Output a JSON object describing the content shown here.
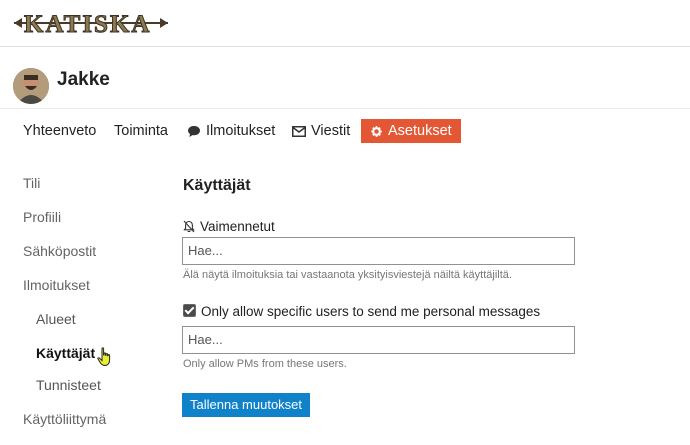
{
  "header": {
    "logo_text": "KATISKA",
    "logo_icon": "fish-trap-logo"
  },
  "profile": {
    "username": "Jakke",
    "avatar_icon": "user-avatar"
  },
  "nav": {
    "tabs": [
      {
        "label": "Yhteenveto"
      },
      {
        "label": "Toiminta"
      },
      {
        "label": "Ilmoitukset",
        "icon": "comment-icon"
      },
      {
        "label": "Viestit",
        "icon": "envelope-icon"
      },
      {
        "label": "Asetukset",
        "icon": "gear-icon",
        "active": true
      }
    ],
    "active_color": "#e45735"
  },
  "sidebar": {
    "items": [
      {
        "label": "Tili"
      },
      {
        "label": "Profiili"
      },
      {
        "label": "Sähköpostit"
      },
      {
        "label": "Ilmoitukset"
      },
      {
        "label": "Alueet"
      },
      {
        "label": "Käyttäjät",
        "current": true
      },
      {
        "label": "Tunnisteet"
      },
      {
        "label": "Käyttöliittymä"
      }
    ]
  },
  "main": {
    "title": "Käyttäjät",
    "muted": {
      "label": "Vaimennetut",
      "icon": "bell-slash-icon",
      "placeholder": "Hae...",
      "hint": "Älä näytä ilmoituksia tai vastaanota yksityisviestejä näiltä käyttäjiltä."
    },
    "allow_pms": {
      "label": "Only allow specific users to send me personal messages",
      "checked": true,
      "placeholder": "Hae...",
      "hint": "Only allow PMs from these users."
    },
    "save_label": "Tallenna muutokset",
    "save_color": "#0f82c9"
  }
}
